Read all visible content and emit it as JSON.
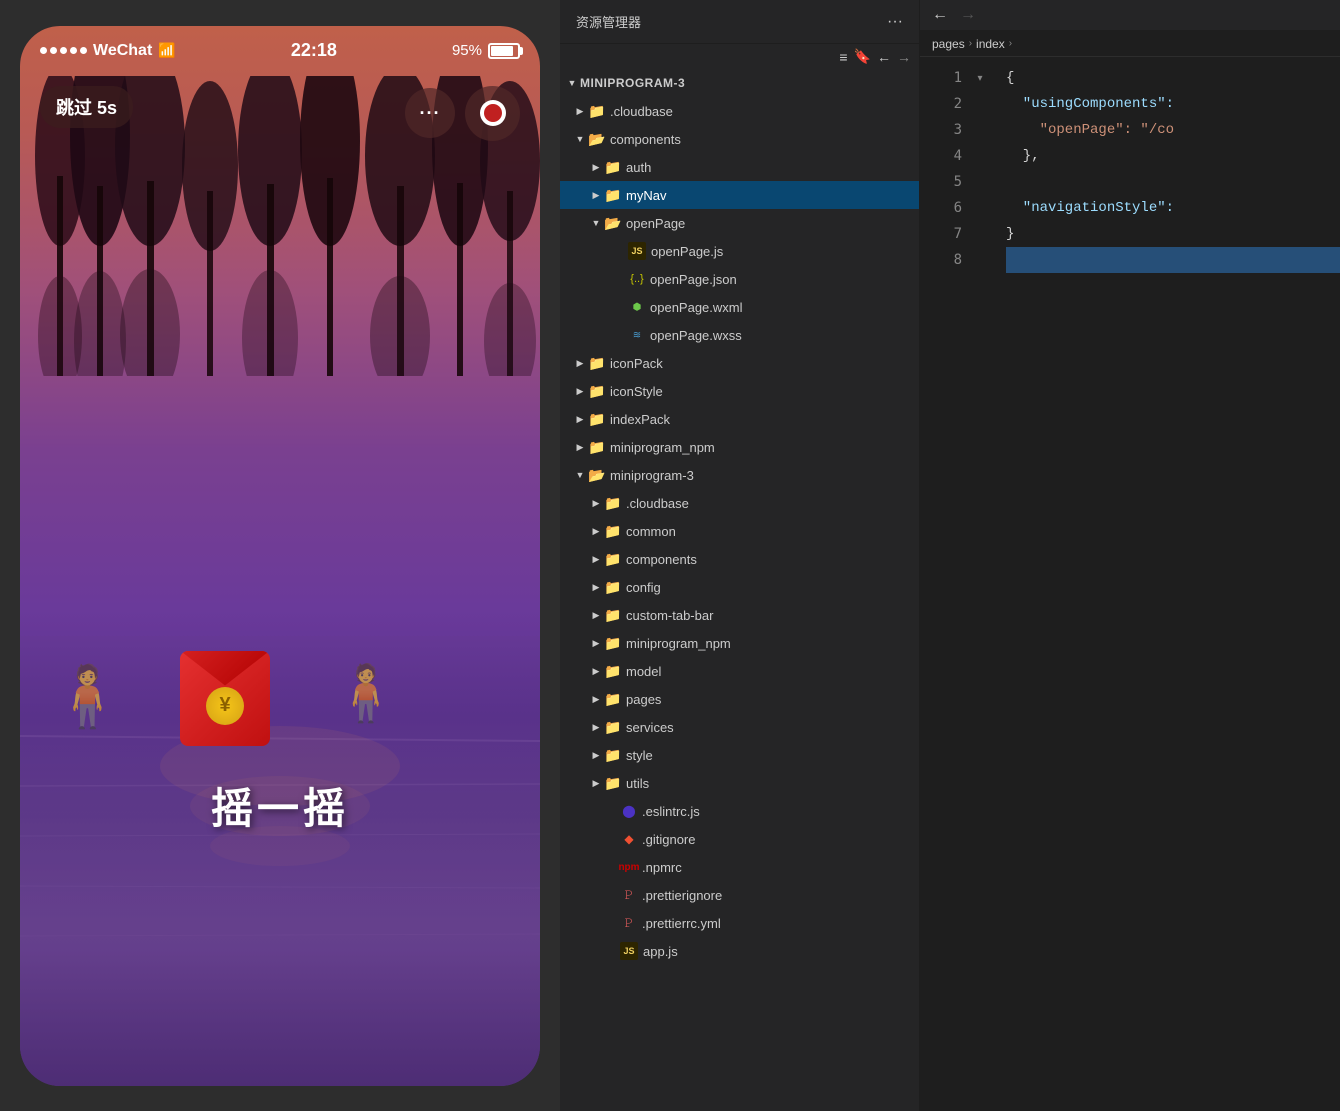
{
  "phone": {
    "status_bar": {
      "carrier": "WeChat",
      "wifi_icon": "wifi",
      "time": "22:18",
      "battery_percent": "95%"
    },
    "skip_button": "跳过 5s",
    "shake_text": "摇一摇",
    "controls": {
      "dots_btn": "···",
      "record_btn": "⏺"
    }
  },
  "explorer": {
    "title": "资源管理器",
    "more_icon": "···",
    "root": "MINIPROGRAM-3",
    "items": [
      {
        "level": 1,
        "type": "folder-collapsed",
        "name": ".cloudbase",
        "color": "plain"
      },
      {
        "level": 1,
        "type": "folder-expanded",
        "name": "components",
        "color": "yellow"
      },
      {
        "level": 2,
        "type": "folder-collapsed",
        "name": "auth",
        "color": "yellow"
      },
      {
        "level": 2,
        "type": "folder-active",
        "name": "myNav",
        "color": "plain"
      },
      {
        "level": 2,
        "type": "folder-expanded",
        "name": "openPage",
        "color": "plain"
      },
      {
        "level": 3,
        "type": "file-js",
        "name": "openPage.js"
      },
      {
        "level": 3,
        "type": "file-json",
        "name": "openPage.json"
      },
      {
        "level": 3,
        "type": "file-wxml",
        "name": "openPage.wxml"
      },
      {
        "level": 3,
        "type": "file-wxss",
        "name": "openPage.wxss"
      },
      {
        "level": 1,
        "type": "folder-collapsed",
        "name": "iconPack",
        "color": "plain"
      },
      {
        "level": 1,
        "type": "folder-collapsed",
        "name": "iconStyle",
        "color": "plain"
      },
      {
        "level": 1,
        "type": "folder-collapsed",
        "name": "indexPack",
        "color": "plain"
      },
      {
        "level": 1,
        "type": "folder-collapsed",
        "name": "miniprogram_npm",
        "color": "plain"
      },
      {
        "level": 1,
        "type": "folder-expanded",
        "name": "miniprogram-3",
        "color": "plain"
      },
      {
        "level": 2,
        "type": "folder-collapsed",
        "name": ".cloudbase",
        "color": "plain"
      },
      {
        "level": 2,
        "type": "folder-collapsed",
        "name": "common",
        "color": "plain"
      },
      {
        "level": 2,
        "type": "folder-collapsed",
        "name": "components",
        "color": "yellow"
      },
      {
        "level": 2,
        "type": "folder-collapsed",
        "name": "config",
        "color": "blue"
      },
      {
        "level": 2,
        "type": "folder-collapsed",
        "name": "custom-tab-bar",
        "color": "plain"
      },
      {
        "level": 2,
        "type": "folder-collapsed",
        "name": "miniprogram_npm",
        "color": "plain"
      },
      {
        "level": 2,
        "type": "folder-collapsed",
        "name": "model",
        "color": "red"
      },
      {
        "level": 2,
        "type": "folder-collapsed",
        "name": "pages",
        "color": "red"
      },
      {
        "level": 2,
        "type": "folder-collapsed",
        "name": "services",
        "color": "yellow"
      },
      {
        "level": 2,
        "type": "folder-collapsed",
        "name": "style",
        "color": "plain"
      },
      {
        "level": 2,
        "type": "folder-collapsed",
        "name": "utils",
        "color": "green"
      },
      {
        "level": 2,
        "type": "file-eslint",
        "name": ".eslintrc.js"
      },
      {
        "level": 2,
        "type": "file-git",
        "name": ".gitignore"
      },
      {
        "level": 2,
        "type": "file-npm",
        "name": ".npmrc"
      },
      {
        "level": 2,
        "type": "file-prettier",
        "name": ".prettierignore"
      },
      {
        "level": 2,
        "type": "file-prettier2",
        "name": ".prettierrc.yml"
      },
      {
        "level": 2,
        "type": "file-js",
        "name": "app.js"
      }
    ]
  },
  "editor": {
    "breadcrumb": [
      "pages",
      ">",
      "index",
      ">"
    ],
    "lines": [
      {
        "num": 1,
        "tokens": [
          {
            "t": "punc",
            "v": "{"
          }
        ]
      },
      {
        "num": 2,
        "tokens": [
          {
            "t": "prop",
            "v": "  \"usingComponents\":"
          },
          {
            "t": "punc",
            "v": " "
          }
        ]
      },
      {
        "num": 3,
        "tokens": [
          {
            "t": "str",
            "v": "    \"openPage\": \"/co"
          }
        ]
      },
      {
        "num": 4,
        "tokens": [
          {
            "t": "punc",
            "v": "  "
          },
          {
            "t": "punc",
            "v": "},"
          }
        ]
      },
      {
        "num": 5,
        "tokens": []
      },
      {
        "num": 6,
        "tokens": [
          {
            "t": "prop",
            "v": "  \"navigationStyle\":"
          }
        ]
      },
      {
        "num": 7,
        "tokens": [
          {
            "t": "punc",
            "v": "}"
          }
        ]
      },
      {
        "num": 8,
        "tokens": []
      }
    ]
  }
}
